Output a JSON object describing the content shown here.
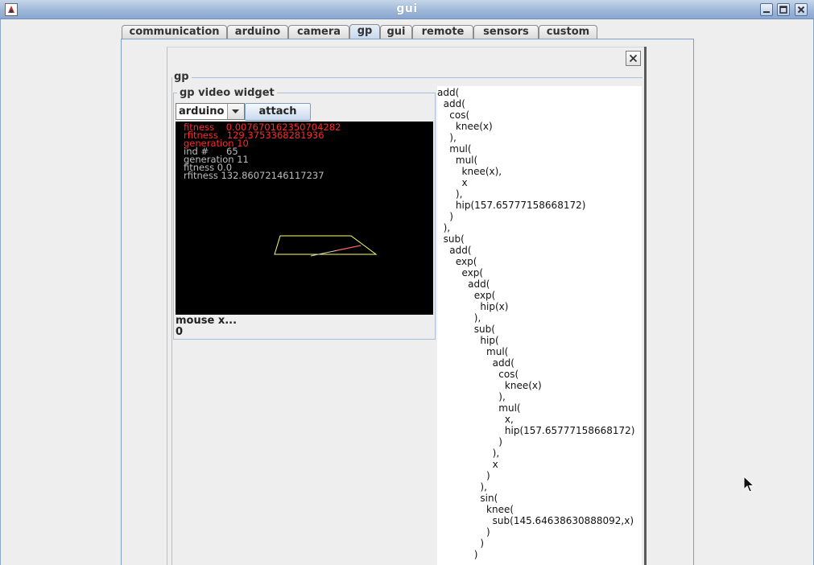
{
  "window": {
    "title": "gui"
  },
  "tabs": [
    {
      "label": "communication",
      "selected": false
    },
    {
      "label": "arduino",
      "selected": false
    },
    {
      "label": "camera",
      "selected": false
    },
    {
      "label": "gp",
      "selected": true
    },
    {
      "label": "gui",
      "selected": false
    },
    {
      "label": "remote",
      "selected": false
    },
    {
      "label": "sensors",
      "selected": false
    },
    {
      "label": "custom",
      "selected": false
    }
  ],
  "panel": {
    "section_label": "gp",
    "video_widget": {
      "title": "gp  video widget",
      "source_select": "arduino",
      "attach_label": "attach",
      "overlay": [
        {
          "text": "fitness    0.007670162350704282",
          "color": "#ff2a2a"
        },
        {
          "text": "rfitness   129.3753368281936",
          "color": "#ff2a2a"
        },
        {
          "text": "generation 10",
          "color": "#ff2a2a"
        },
        {
          "text": "ind #      65",
          "color": "#bdbdbd"
        },
        {
          "text": "generation 11",
          "color": "#bdbdbd"
        },
        {
          "text": "fitness 0.0",
          "color": "#bdbdbd"
        },
        {
          "text": "rfitness 132.86072146117237",
          "color": "#bdbdbd"
        }
      ]
    },
    "mouse_label": "mouse x...",
    "mouse_value": "0",
    "program_lines": [
      "add(",
      "  add(",
      "    cos(",
      "      knee(x)",
      "    ),",
      "    mul(",
      "      mul(",
      "        knee(x),",
      "        x",
      "      ),",
      "      hip(157.65777158668172)",
      "    )",
      "  ),",
      "  sub(",
      "    add(",
      "      exp(",
      "        exp(",
      "          add(",
      "            exp(",
      "              hip(x)",
      "            ),",
      "            sub(",
      "              hip(",
      "                mul(",
      "                  add(",
      "                    cos(",
      "                      knee(x)",
      "                    ),",
      "                    mul(",
      "                      x,",
      "                      hip(157.65777158668172)",
      "                    )",
      "                  ),",
      "                  x",
      "                )",
      "              ),",
      "              sin(",
      "                knee(",
      "                  sub(145.64638630888092,x)",
      "                )",
      "              )",
      "            )"
    ]
  },
  "colors": {
    "accent": "#7f9fc8",
    "overlay_red": "#ff2a2a",
    "overlay_gray": "#bdbdbd",
    "shape_yellow": "#ffff66"
  }
}
